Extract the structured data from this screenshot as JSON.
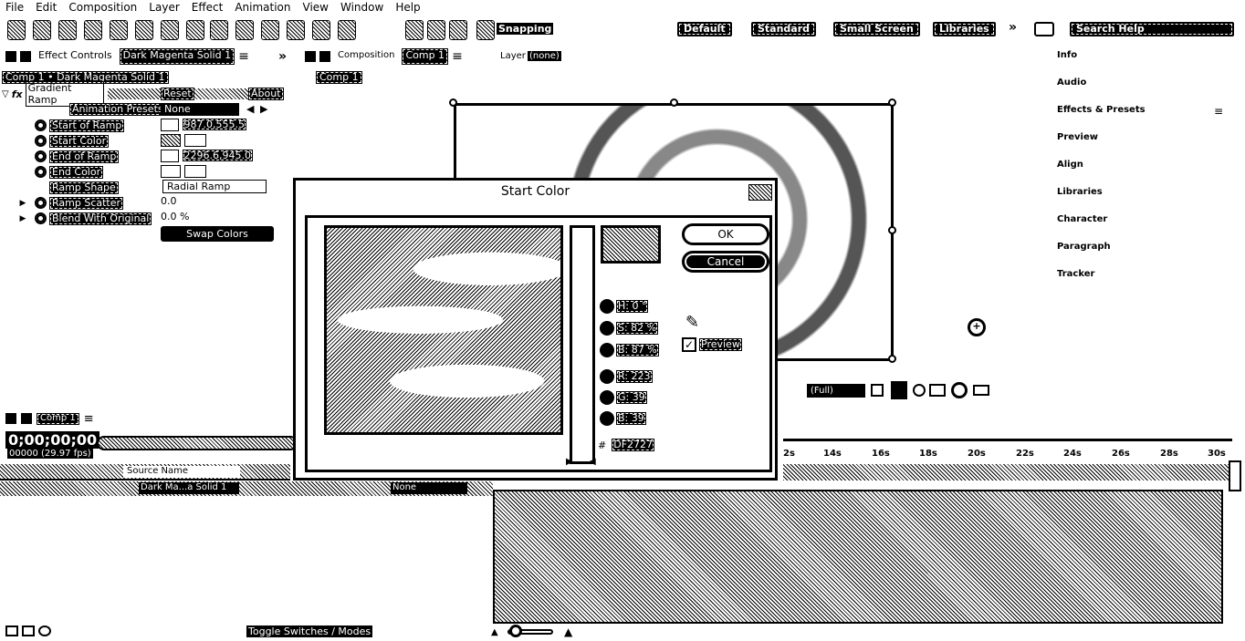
{
  "menu": [
    "File",
    "Edit",
    "Composition",
    "Layer",
    "Effect",
    "Animation",
    "View",
    "Window",
    "Help"
  ],
  "toolbar": {
    "snapping": "Snapping",
    "workspaces": [
      "Default",
      "Standard",
      "Small Screen",
      "Libraries"
    ],
    "search": "Search Help"
  },
  "effect_controls": {
    "tab_label": "Effect Controls",
    "tab_layer": "Dark Magenta Solid 1",
    "breadcrumb": "Comp 1 • Dark Magenta Solid 1",
    "effect_name": "Gradient Ramp",
    "reset": "Reset",
    "about": "About",
    "presets_label": "Animation Presets:",
    "presets_value": "None",
    "props": [
      {
        "name": "Start of Ramp",
        "value": "987.0,555.5"
      },
      {
        "name": "Start Color",
        "value": ""
      },
      {
        "name": "End of Ramp",
        "value": "2296.6,945.0"
      },
      {
        "name": "End Color",
        "value": ""
      },
      {
        "name": "Ramp Shape",
        "value": "Radial Ramp"
      },
      {
        "name": "Ramp Scatter",
        "value": "0.0"
      },
      {
        "name": "Blend With Original",
        "value": "0.0 %"
      }
    ],
    "swap": "Swap Colors"
  },
  "composition": {
    "tab_label": "Composition",
    "tab_name": "Comp 1",
    "layer_label": "Layer",
    "layer_value": "(none)",
    "flow_tab": "Comp 1"
  },
  "workspace_panels": [
    "Info",
    "Audio",
    "Effects & Presets",
    "Preview",
    "Align",
    "Libraries",
    "Character",
    "Paragraph",
    "Tracker"
  ],
  "timeline": {
    "tab": "Comp 1",
    "timecode": "0;00;00;00",
    "fps": "00000 (29.97 fps)",
    "source_name": "Source Name",
    "layer_name": "Dark Ma...a Solid 1",
    "parent": "None",
    "toggle": "Toggle Switches / Modes",
    "ticks": [
      "2s",
      "14s",
      "16s",
      "18s",
      "20s",
      "22s",
      "24s",
      "26s",
      "28s",
      "30s"
    ],
    "zoom": "(Full)"
  },
  "dialog": {
    "title": "Start Color",
    "ok": "OK",
    "cancel": "Cancel",
    "preview": "Preview",
    "h": "H: 0 °",
    "s": "S: 82 %",
    "b": "B: 87 %",
    "r": "R: 223",
    "g": "G: 39",
    "bl": "B: 39",
    "hex": "DF2727",
    "hash": "#"
  }
}
